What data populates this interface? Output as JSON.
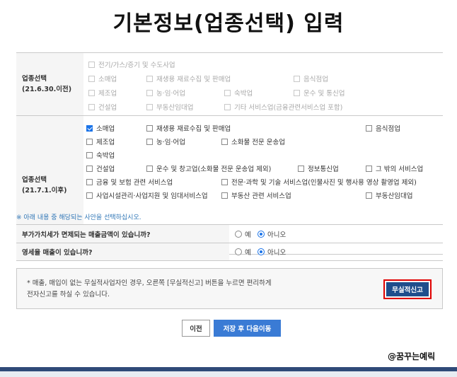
{
  "page_title": "기본정보(업종선택) 입력",
  "category_old": {
    "label_line1": "업종선택",
    "label_line2": "(21.6.30.이전)",
    "items": [
      {
        "label": "전기/가스/증기 및 수도사업",
        "checked": false
      },
      {
        "label": "소매업",
        "checked": false
      },
      {
        "label": "재생용 재료수집 및 판매업",
        "checked": false
      },
      {
        "label": "음식점업",
        "checked": false
      },
      {
        "label": "제조업",
        "checked": false
      },
      {
        "label": "농·임·어업",
        "checked": false
      },
      {
        "label": "숙박업",
        "checked": false
      },
      {
        "label": "운수 및 통신업",
        "checked": false
      },
      {
        "label": "건설업",
        "checked": false
      },
      {
        "label": "부동산임대업",
        "checked": false
      },
      {
        "label": "기타 서비스업(금융관련서비스업 포함)",
        "checked": false
      }
    ]
  },
  "category_new": {
    "label_line1": "업종선택",
    "label_line2": "(21.7.1.이후)",
    "items": [
      {
        "label": "소매업",
        "checked": true
      },
      {
        "label": "재생용 재료수집 및 판매업",
        "checked": false
      },
      {
        "label": "음식점업",
        "checked": false
      },
      {
        "label": "제조업",
        "checked": false
      },
      {
        "label": "농·임·어업",
        "checked": false
      },
      {
        "label": "소화물 전문 운송업",
        "checked": false
      },
      {
        "label": "숙박업",
        "checked": false
      },
      {
        "label": "건설업",
        "checked": false
      },
      {
        "label": "운수 및 창고업(소화물 전문 운송업 제외)",
        "checked": false
      },
      {
        "label": "정보통신업",
        "checked": false
      },
      {
        "label": "그 밖의 서비스업",
        "checked": false
      },
      {
        "label": "금융 및 보험 관련 서비스업",
        "checked": false
      },
      {
        "label": "전문·과학 및 기술 서비스업(인물사진 및 행사용 영상 촬영업 제외)",
        "checked": false
      },
      {
        "label": "사업시설관리·사업지원 및 임대서비스업",
        "checked": false
      },
      {
        "label": "부동산 관련 서비스업",
        "checked": false
      },
      {
        "label": "부동산임대업",
        "checked": false
      }
    ]
  },
  "notice": "※ 아래 내용 중 해당되는 사안을 선택하십시오.",
  "questions": [
    {
      "label": "부가가치세가 면제되는 매출금액이 있습니까?",
      "yes": "예",
      "no": "아니오",
      "selected": "no"
    },
    {
      "label": "영세율 매출이 있습니까?",
      "yes": "예",
      "no": "아니오",
      "selected": "no"
    }
  ],
  "info": {
    "line1": "* 매출, 매입이 없는 무실적사업자인 경우, 오른쪽 [무실적신고] 버튼을 누르면 편리하게",
    "line2": "전자신고를 하실 수 있습니다.",
    "button": "무실적신고"
  },
  "buttons": {
    "prev": "이전",
    "next": "저장 후 다음이동"
  },
  "watermark": "@꿈꾸는예릭",
  "colors": {
    "accent": "#1a73e8",
    "primary_button": "#3a7bd5",
    "dark_button": "#1f4e8c",
    "highlight": "#e00000",
    "notice": "#2e75b6"
  }
}
